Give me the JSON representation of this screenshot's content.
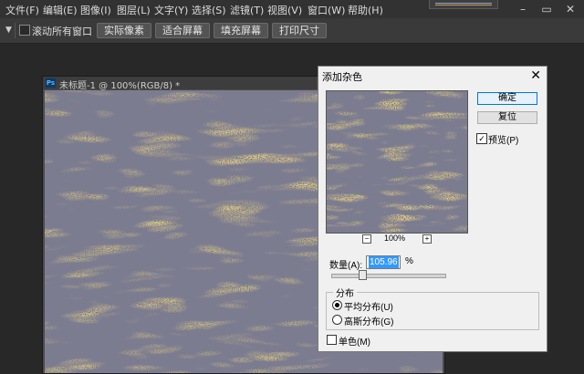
{
  "menubar": {
    "items": [
      "文件(F)",
      "编辑(E)",
      "图像(I)",
      "图层(L)",
      "文字(Y)",
      "选择(S)",
      "滤镜(T)",
      "视图(V)",
      "窗口(W)",
      "帮助(H)"
    ],
    "window_controls": [
      "–",
      "▭",
      "✕"
    ]
  },
  "options_bar": {
    "scroll_all_windows": "滚动所有窗口",
    "scroll_all_checked": false,
    "buttons": [
      "实际像素",
      "适合屏幕",
      "填充屏幕",
      "打印尺寸"
    ]
  },
  "document": {
    "app_badge": "Ps",
    "title": "未标题-1 @ 100%(RGB/8) *"
  },
  "dialog": {
    "title": "添加杂色",
    "close": "✕",
    "ok": "确定",
    "reset": "复位",
    "preview_label": "预览(P)",
    "preview_checked": true,
    "zoom_out": "−",
    "zoom_in": "+",
    "zoom_level": "100%",
    "amount_label": "数量(A):",
    "amount_value": "105.96",
    "amount_unit": "%",
    "amount_slider_fraction": 0.27,
    "distribution_legend": "分布",
    "uniform_label": "平均分布(U)",
    "gaussian_label": "高斯分布(G)",
    "distribution_selected": "uniform",
    "monochromatic_label": "单色(M)",
    "monochromatic_checked": false
  },
  "colors": {
    "menu_bg": "#323232",
    "workspace_bg": "#282828",
    "selection_blue": "#3399ff"
  }
}
